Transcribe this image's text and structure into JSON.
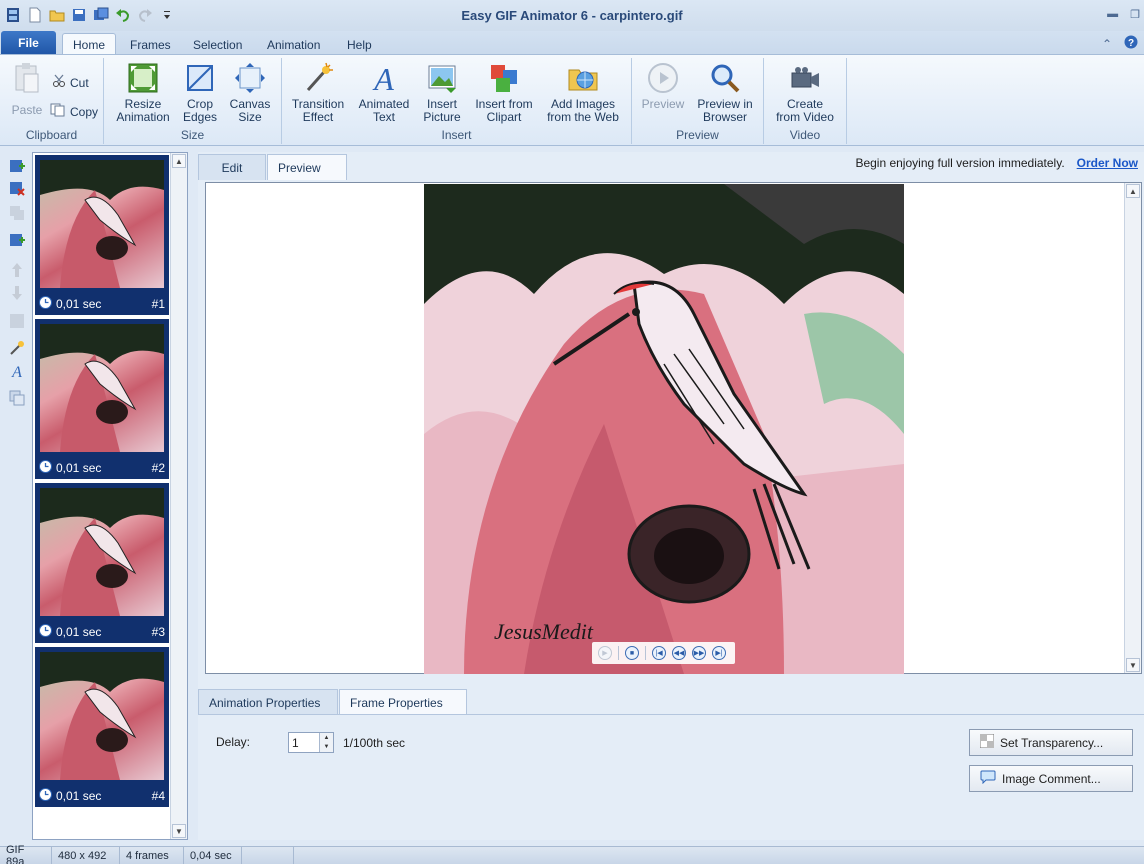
{
  "window": {
    "title": "Easy GIF Animator 6 - carpintero.gif",
    "qat_icons": [
      "app-icon",
      "new-icon",
      "open-icon",
      "save-icon",
      "save-all-icon",
      "undo-icon",
      "redo-icon",
      "customize-icon"
    ]
  },
  "menu": {
    "file": "File",
    "tabs": [
      {
        "label": "Home"
      },
      {
        "label": "Frames"
      },
      {
        "label": "Selection"
      },
      {
        "label": "Animation"
      },
      {
        "label": "Help"
      }
    ]
  },
  "ribbon": {
    "clipboard": {
      "label": "Clipboard",
      "paste": "Paste",
      "cut": "Cut",
      "copy": "Copy"
    },
    "size": {
      "label": "Size",
      "resize": [
        "Resize",
        "Animation"
      ],
      "crop": [
        "Crop",
        "Edges"
      ],
      "canvas": [
        "Canvas",
        "Size"
      ]
    },
    "insert": {
      "label": "Insert",
      "transition": [
        "Transition",
        "Effect"
      ],
      "animated_text": [
        "Animated",
        "Text"
      ],
      "insert_picture": [
        "Insert",
        "Picture"
      ],
      "insert_clipart": [
        "Insert from",
        "Clipart"
      ],
      "add_images": [
        "Add Images",
        "from the Web"
      ]
    },
    "preview": {
      "label": "Preview",
      "preview": [
        "Preview",
        ""
      ],
      "preview_browser": [
        "Preview in",
        "Browser"
      ]
    },
    "video": {
      "label": "Video",
      "create": [
        "Create",
        "from Video"
      ]
    }
  },
  "frames": [
    {
      "delay": "0,01 sec",
      "num": "#1"
    },
    {
      "delay": "0,01 sec",
      "num": "#2"
    },
    {
      "delay": "0,01 sec",
      "num": "#3"
    },
    {
      "delay": "0,01 sec",
      "num": "#4"
    }
  ],
  "editor": {
    "tab_edit": "Edit",
    "tab_preview": "Preview",
    "promo_text": "Begin enjoying full version immediately.",
    "order_now": "Order Now",
    "signature": "JesusMedit"
  },
  "properties": {
    "tab_animation": "Animation Properties",
    "tab_frame": "Frame Properties",
    "delay_label": "Delay:",
    "delay_value": "1",
    "delay_unit": "1/100th sec",
    "set_transparency": "Set Transparency...",
    "image_comment": "Image Comment..."
  },
  "status": {
    "format": "GIF 89a",
    "dimensions": "480 x 492",
    "frames": "4 frames",
    "duration": "0,04 sec"
  },
  "colors": {
    "accent": "#1f55a6",
    "frame_bg": "#11306e",
    "link": "#1a57c8"
  }
}
